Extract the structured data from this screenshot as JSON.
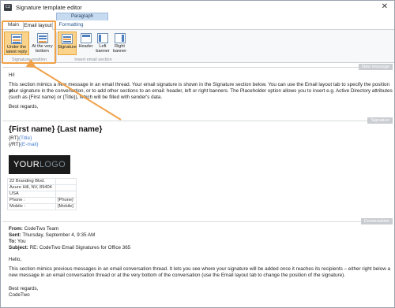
{
  "window": {
    "title": "Signature template editor",
    "app_icon_glyph": "C2",
    "close_glyph": "✕"
  },
  "ribbon": {
    "context_tab": "Paragraph",
    "tabs": [
      {
        "label": "Main"
      },
      {
        "label": "Email layout"
      },
      {
        "label": "Formatting"
      }
    ],
    "signature_position": {
      "group_label": "Signature position",
      "buttons": [
        {
          "label": "Under the latest reply",
          "selected": true
        },
        {
          "label": "At the very bottom",
          "selected": false
        }
      ]
    },
    "insert_email_section": {
      "group_label": "Insert email section",
      "buttons": [
        {
          "label": "Signature",
          "selected": true
        },
        {
          "label": "Header",
          "selected": false
        },
        {
          "label": "Left banner",
          "selected": false
        },
        {
          "label": "Right banner",
          "selected": false
        }
      ]
    }
  },
  "new_message": {
    "label": "New message",
    "greeting": "Hi!",
    "body_lines": [
      "This section mimics a new message in an email thread. Your email signature is shown in the Signature section below. You can use the Email layout tab to specify the position of",
      "your signature in the conversation, or to add other sections to an email: header, left or right banners. The Placeholder option allows you to insert e.g. Active Directory attributes",
      "(such as {First name} or {Title}), which will be filled with sender's data."
    ],
    "closing": "Best regards,"
  },
  "signature": {
    "label": "Signature",
    "name": "{First name} {Last name}",
    "title_prefix": "{RT}",
    "title_value": "{Title}",
    "email_prefix": "{/RT}",
    "email_value": "{E-mail}",
    "logo_part1": "YOUR",
    "logo_part2": "LOGO",
    "address_rows": [
      {
        "left": "22 Branding Blvd.",
        "right": ""
      },
      {
        "left": "Azure Hill, NV, 89404",
        "right": ""
      },
      {
        "left": "USA",
        "right": ""
      },
      {
        "left": "Phone :",
        "right": "{Phone}"
      },
      {
        "left": "Mobile :",
        "right": "{Mobile}"
      }
    ]
  },
  "conversation": {
    "label": "Conversation",
    "from_label": "From:",
    "from_value": "CodeTwo Team",
    "sent_label": "Sent:",
    "sent_value": "Thursday, September 4, 9:35 AM",
    "to_label": "To:",
    "to_value": "You",
    "subject_label": "Subject:",
    "subject_value": "RE: CodeTwo Email Signatures for Office 365",
    "greeting": "Hello,",
    "body_lines": [
      "This section mimics previous messages in an email conversation thread. It lets you see where your signature will be added once it reaches its recipients – either right below a",
      "new message in an email conversation thread or at the very bottom of the conversation (use the Email layout tab to change the position of the signature)."
    ],
    "closing": "Best regards,",
    "sign_off": "CodeTwo"
  },
  "colors": {
    "selected_fill": "#fbd38a",
    "callout_orange": "#f0a24a",
    "placeholder_blue": "#4a7fd0"
  }
}
